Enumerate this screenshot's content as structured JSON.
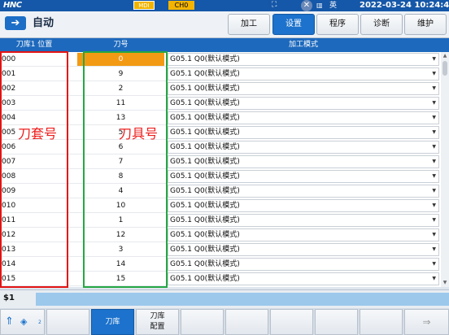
{
  "topbar": {
    "logo": "HNC",
    "mode": "MDI",
    "channel": "CH0",
    "keyboard": "▥",
    "language": "英",
    "clock": "2022-03-24 10:24:42"
  },
  "header": {
    "mode_label": "自动",
    "tabs": [
      {
        "label": "加工",
        "active": false
      },
      {
        "label": "设置",
        "active": true
      },
      {
        "label": "程序",
        "active": false
      },
      {
        "label": "诊断",
        "active": false
      },
      {
        "label": "维护",
        "active": false
      }
    ]
  },
  "table": {
    "columns": {
      "position": "刀库1 位置",
      "tool": "刀号",
      "mode": "加工模式"
    },
    "rows": [
      {
        "position": "000",
        "tool": "0",
        "mode": "G05.1 Q0(默认模式)",
        "selected": true
      },
      {
        "position": "001",
        "tool": "9",
        "mode": "G05.1 Q0(默认模式)"
      },
      {
        "position": "002",
        "tool": "2",
        "mode": "G05.1 Q0(默认模式)"
      },
      {
        "position": "003",
        "tool": "11",
        "mode": "G05.1 Q0(默认模式)"
      },
      {
        "position": "004",
        "tool": "13",
        "mode": "G05.1 Q0(默认模式)"
      },
      {
        "position": "005",
        "tool": "5",
        "mode": "G05.1 Q0(默认模式)"
      },
      {
        "position": "006",
        "tool": "6",
        "mode": "G05.1 Q0(默认模式)"
      },
      {
        "position": "007",
        "tool": "7",
        "mode": "G05.1 Q0(默认模式)"
      },
      {
        "position": "008",
        "tool": "8",
        "mode": "G05.1 Q0(默认模式)"
      },
      {
        "position": "009",
        "tool": "4",
        "mode": "G05.1 Q0(默认模式)"
      },
      {
        "position": "010",
        "tool": "10",
        "mode": "G05.1 Q0(默认模式)"
      },
      {
        "position": "011",
        "tool": "1",
        "mode": "G05.1 Q0(默认模式)"
      },
      {
        "position": "012",
        "tool": "12",
        "mode": "G05.1 Q0(默认模式)"
      },
      {
        "position": "013",
        "tool": "3",
        "mode": "G05.1 Q0(默认模式)"
      },
      {
        "position": "014",
        "tool": "14",
        "mode": "G05.1 Q0(默认模式)"
      },
      {
        "position": "015",
        "tool": "15",
        "mode": "G05.1 Q0(默认模式)"
      }
    ]
  },
  "annotations": {
    "pocket_label": "刀套号",
    "tool_label": "刀具号",
    "pocket_color": "#e31414",
    "tool_color": "#24a844"
  },
  "command": {
    "label": "$1",
    "value": ""
  },
  "softkeys": {
    "page_indicator": "2",
    "items": [
      {
        "label": "",
        "active": false
      },
      {
        "label": "刀库",
        "active": true
      },
      {
        "label": "刀库",
        "label2": "配置",
        "active": false
      },
      {
        "label": "",
        "active": false
      },
      {
        "label": "",
        "active": false
      },
      {
        "label": "",
        "active": false
      },
      {
        "label": "",
        "active": false
      },
      {
        "label": "",
        "active": false
      },
      {
        "label": "",
        "active": false
      }
    ]
  },
  "colors": {
    "topbar": "#1557a8",
    "accent": "#1c72cc",
    "selected_cell": "#f29a14",
    "command_input": "#9cc8ec"
  }
}
